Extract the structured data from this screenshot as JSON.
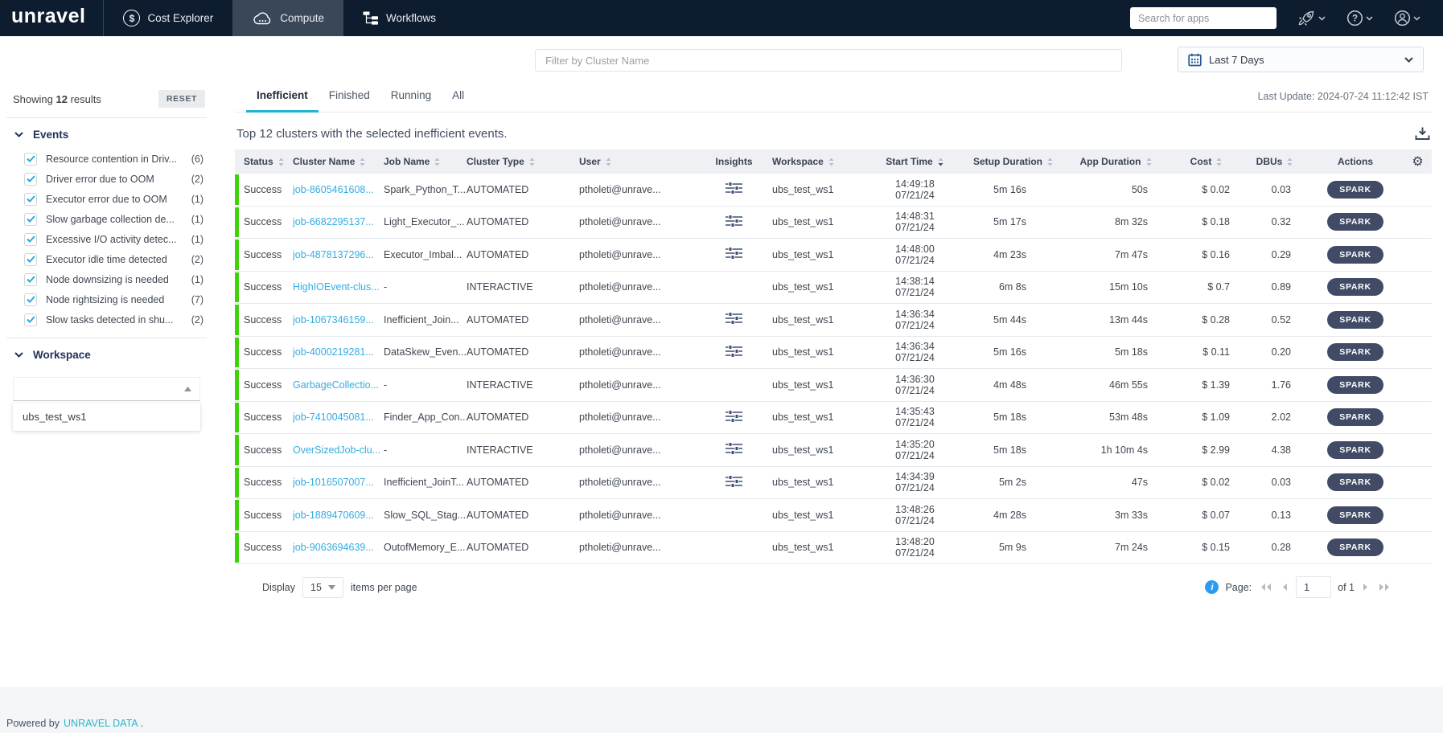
{
  "navbar": {
    "brand": "unravel",
    "items": {
      "cost_explorer": "Cost Explorer",
      "compute": "Compute",
      "workflows": "Workflows"
    },
    "search_placeholder": "Search for apps"
  },
  "filter_bar": {
    "cluster_filter_placeholder": "Filter by Cluster Name",
    "date_range": "Last 7 Days"
  },
  "sidebar": {
    "showing_prefix": "Showing",
    "showing_count": "12",
    "showing_suffix": "results",
    "reset_label": "RESET",
    "events": {
      "title": "Events",
      "items": [
        {
          "label": "Resource contention in Driv...",
          "count": "(6)"
        },
        {
          "label": "Driver error due to OOM",
          "count": "(2)"
        },
        {
          "label": "Executor error due to OOM",
          "count": "(1)"
        },
        {
          "label": "Slow garbage collection de...",
          "count": "(1)"
        },
        {
          "label": "Excessive I/O activity detec...",
          "count": "(1)"
        },
        {
          "label": "Executor idle time detected",
          "count": "(2)"
        },
        {
          "label": "Node downsizing is needed",
          "count": "(1)"
        },
        {
          "label": "Node rightsizing is needed",
          "count": "(7)"
        },
        {
          "label": "Slow tasks detected in shu...",
          "count": "(2)"
        }
      ]
    },
    "workspace": {
      "title": "Workspace",
      "options": [
        {
          "label": "ubs_test_ws1"
        }
      ]
    }
  },
  "main": {
    "tabs": [
      {
        "label": "Inefficient",
        "active": true
      },
      {
        "label": "Finished"
      },
      {
        "label": "Running"
      },
      {
        "label": "All"
      }
    ],
    "last_update": "Last Update: 2024-07-24 11:12:42 IST",
    "heading": "Top 12 clusters with the selected inefficient events.",
    "table": {
      "columns": [
        {
          "label": "Status",
          "sortable": true
        },
        {
          "label": "Cluster Name",
          "sortable": true
        },
        {
          "label": "Job Name",
          "sortable": true
        },
        {
          "label": "Cluster Type",
          "sortable": true
        },
        {
          "label": "User",
          "sortable": true
        },
        {
          "label": "Insights",
          "sortable": false
        },
        {
          "label": "Workspace",
          "sortable": true
        },
        {
          "label": "Start Time",
          "sortable": true,
          "sorted": true
        },
        {
          "label": "Setup Duration",
          "sortable": true
        },
        {
          "label": "App Duration",
          "sortable": true
        },
        {
          "label": "Cost",
          "sortable": true
        },
        {
          "label": "DBUs",
          "sortable": true
        },
        {
          "label": "Actions",
          "sortable": false
        }
      ],
      "rows": [
        {
          "status": "Success",
          "cluster": "job-8605461608...",
          "job": "Spark_Python_T...",
          "type": "AUTOMATED",
          "user": "ptholeti@unrave...",
          "insights": true,
          "workspace": "ubs_test_ws1",
          "time": "14:49:18",
          "date": "07/21/24",
          "setup": "5m 16s",
          "app": "50s",
          "cost": "$ 0.02",
          "dbus": "0.03",
          "action": "SPARK"
        },
        {
          "status": "Success",
          "cluster": "job-6682295137...",
          "job": "Light_Executor_...",
          "type": "AUTOMATED",
          "user": "ptholeti@unrave...",
          "insights": true,
          "workspace": "ubs_test_ws1",
          "time": "14:48:31",
          "date": "07/21/24",
          "setup": "5m 17s",
          "app": "8m 32s",
          "cost": "$ 0.18",
          "dbus": "0.32",
          "action": "SPARK"
        },
        {
          "status": "Success",
          "cluster": "job-4878137296...",
          "job": "Executor_Imbal...",
          "type": "AUTOMATED",
          "user": "ptholeti@unrave...",
          "insights": true,
          "workspace": "ubs_test_ws1",
          "time": "14:48:00",
          "date": "07/21/24",
          "setup": "4m 23s",
          "app": "7m 47s",
          "cost": "$ 0.16",
          "dbus": "0.29",
          "action": "SPARK"
        },
        {
          "status": "Success",
          "cluster": "HighIOEvent-clus...",
          "job": "-",
          "type": "INTERACTIVE",
          "user": "ptholeti@unrave...",
          "insights": false,
          "workspace": "ubs_test_ws1",
          "time": "14:38:14",
          "date": "07/21/24",
          "setup": "6m 8s",
          "app": "15m 10s",
          "cost": "$ 0.7",
          "dbus": "0.89",
          "action": "SPARK"
        },
        {
          "status": "Success",
          "cluster": "job-1067346159...",
          "job": "Inefficient_Join...",
          "type": "AUTOMATED",
          "user": "ptholeti@unrave...",
          "insights": true,
          "workspace": "ubs_test_ws1",
          "time": "14:36:34",
          "date": "07/21/24",
          "setup": "5m 44s",
          "app": "13m 44s",
          "cost": "$ 0.28",
          "dbus": "0.52",
          "action": "SPARK"
        },
        {
          "status": "Success",
          "cluster": "job-4000219281...",
          "job": "DataSkew_Even...",
          "type": "AUTOMATED",
          "user": "ptholeti@unrave...",
          "insights": true,
          "workspace": "ubs_test_ws1",
          "time": "14:36:34",
          "date": "07/21/24",
          "setup": "5m 16s",
          "app": "5m 18s",
          "cost": "$ 0.11",
          "dbus": "0.20",
          "action": "SPARK"
        },
        {
          "status": "Success",
          "cluster": "GarbageCollectio...",
          "job": "-",
          "type": "INTERACTIVE",
          "user": "ptholeti@unrave...",
          "insights": false,
          "workspace": "ubs_test_ws1",
          "time": "14:36:30",
          "date": "07/21/24",
          "setup": "4m 48s",
          "app": "46m 55s",
          "cost": "$ 1.39",
          "dbus": "1.76",
          "action": "SPARK"
        },
        {
          "status": "Success",
          "cluster": "job-7410045081...",
          "job": "Finder_App_Con...",
          "type": "AUTOMATED",
          "user": "ptholeti@unrave...",
          "insights": true,
          "workspace": "ubs_test_ws1",
          "time": "14:35:43",
          "date": "07/21/24",
          "setup": "5m 18s",
          "app": "53m 48s",
          "cost": "$ 1.09",
          "dbus": "2.02",
          "action": "SPARK"
        },
        {
          "status": "Success",
          "cluster": "OverSizedJob-clu...",
          "job": "-",
          "type": "INTERACTIVE",
          "user": "ptholeti@unrave...",
          "insights": true,
          "workspace": "ubs_test_ws1",
          "time": "14:35:20",
          "date": "07/21/24",
          "setup": "5m 18s",
          "app": "1h 10m 4s",
          "cost": "$ 2.99",
          "dbus": "4.38",
          "action": "SPARK"
        },
        {
          "status": "Success",
          "cluster": "job-1016507007...",
          "job": "Inefficient_JoinT...",
          "type": "AUTOMATED",
          "user": "ptholeti@unrave...",
          "insights": true,
          "workspace": "ubs_test_ws1",
          "time": "14:34:39",
          "date": "07/21/24",
          "setup": "5m 2s",
          "app": "47s",
          "cost": "$ 0.02",
          "dbus": "0.03",
          "action": "SPARK"
        },
        {
          "status": "Success",
          "cluster": "job-1889470609...",
          "job": "Slow_SQL_Stag...",
          "type": "AUTOMATED",
          "user": "ptholeti@unrave...",
          "insights": false,
          "workspace": "ubs_test_ws1",
          "time": "13:48:26",
          "date": "07/21/24",
          "setup": "4m 28s",
          "app": "3m 33s",
          "cost": "$ 0.07",
          "dbus": "0.13",
          "action": "SPARK"
        },
        {
          "status": "Success",
          "cluster": "job-9063694639...",
          "job": "OutofMemory_E...",
          "type": "AUTOMATED",
          "user": "ptholeti@unrave...",
          "insights": false,
          "workspace": "ubs_test_ws1",
          "time": "13:48:20",
          "date": "07/21/24",
          "setup": "5m 9s",
          "app": "7m 24s",
          "cost": "$ 0.15",
          "dbus": "0.28",
          "action": "SPARK"
        }
      ]
    },
    "pagination": {
      "display_label": "Display",
      "page_size": "15",
      "items_label": "items per page",
      "page_label": "Page:",
      "current_page": "1",
      "of_label": "of 1"
    }
  },
  "footer": {
    "powered_by": "Powered by",
    "link": "UNRAVEL DATA",
    "period": "."
  },
  "colors": {
    "navbar_bg": "#0e1c30",
    "accent_cyan": "#20b4d2",
    "link_blue": "#34ace2",
    "status_green": "#3ed10f",
    "pill_bg": "#424b66",
    "info_blue": "#2d9cf0"
  }
}
